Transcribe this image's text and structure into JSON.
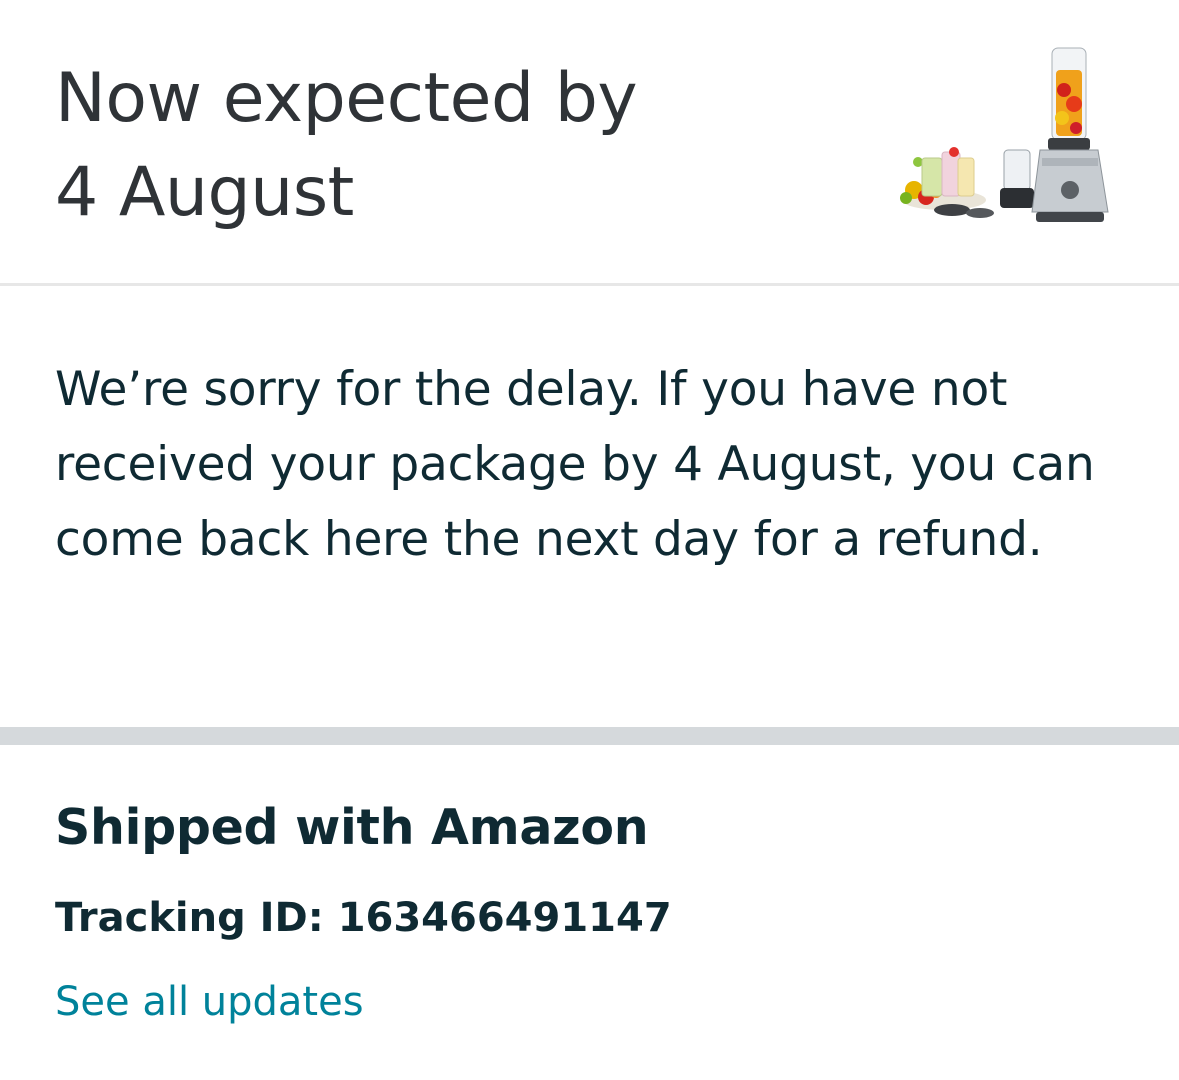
{
  "delivery": {
    "expected_line1": "Now expected by",
    "expected_line2": "4 August"
  },
  "product": {
    "icon": "blender-product-image"
  },
  "message": {
    "text": "We’re sorry for the delay. If you have not received your package by 4 August, you can come back here the next day for a refund."
  },
  "shipment": {
    "title": "Shipped with Amazon",
    "tracking_label": "Tracking ID:",
    "tracking_id": "163466491147",
    "see_all_label": "See all updates"
  },
  "colors": {
    "heading_text": "#2f3337",
    "body_text": "#0f2a33",
    "link": "#00829a",
    "divider_thin": "#e7e7e7",
    "divider_thick": "#d5d9dc"
  }
}
